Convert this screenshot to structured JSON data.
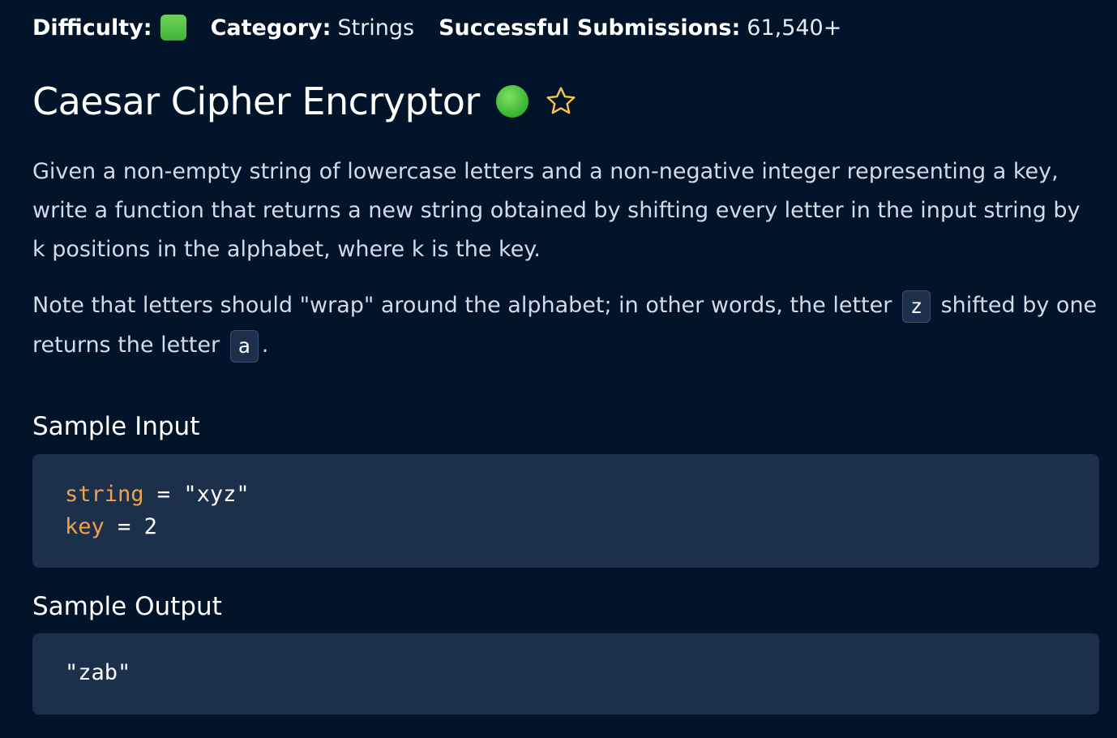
{
  "meta": {
    "difficulty_label": "Difficulty:",
    "category_label": "Category:",
    "category_value": "Strings",
    "submissions_label": "Successful Submissions:",
    "submissions_value": "61,540+"
  },
  "title": "Caesar Cipher Encryptor",
  "description": "Given a non-empty string of lowercase letters and a non-negative integer representing a key, write a function that returns a new string obtained by shifting every letter in the input string by k positions in the alphabet, where k is the key.",
  "note": {
    "part1": "Note that letters should \"wrap\" around the alphabet; in other words, the letter",
    "code1": "z",
    "part2": "shifted by one returns the letter",
    "code2": "a",
    "part3": "."
  },
  "sample_input": {
    "heading": "Sample Input",
    "lines": [
      {
        "name": "string",
        "op": " = ",
        "value": "\"xyz\""
      },
      {
        "name": "key",
        "op": " = ",
        "value": "2"
      }
    ]
  },
  "sample_output": {
    "heading": "Sample Output",
    "value": "\"zab\""
  },
  "colors": {
    "background": "#02142a",
    "code_background": "#1c2f4b",
    "keyword": "#f0a24a",
    "difficulty_green": "#4cc24a",
    "star_outline": "#f2c14e"
  },
  "icons": {
    "difficulty": "green-square-icon",
    "status": "green-circle-icon",
    "favorite": "star-outline-icon"
  }
}
